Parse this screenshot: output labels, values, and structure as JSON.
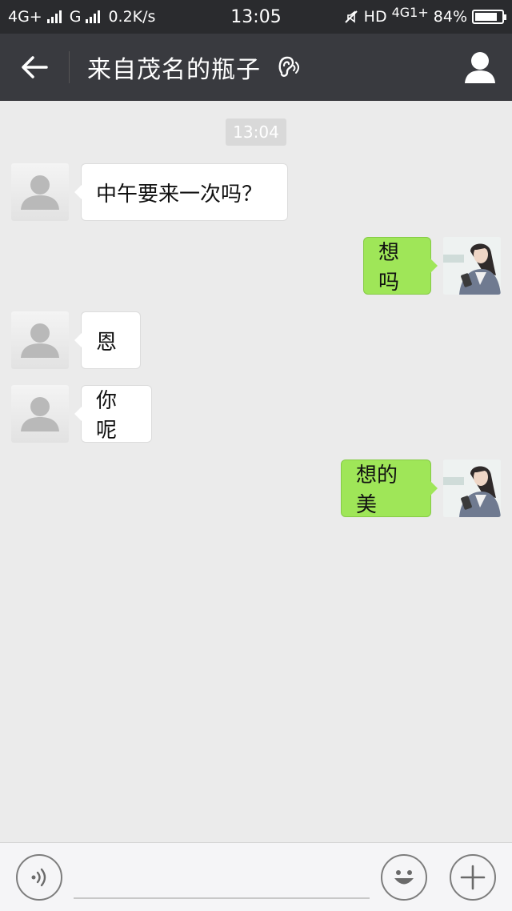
{
  "status_bar": {
    "network1": "4G+",
    "network2": "G",
    "speed": "0.2K/s",
    "time": "13:05",
    "hd_label": "HD",
    "network3": "4G",
    "network3_sub": "1+",
    "battery_text": "84%",
    "battery_level": 0.84
  },
  "header": {
    "title": "来自茂名的瓶子",
    "back_icon": "arrow-left-icon",
    "ear_icon": "ear-icon",
    "profile_icon": "person-icon"
  },
  "chat": {
    "timestamp": "13:04",
    "messages": [
      {
        "side": "in",
        "text": "中午要来一次吗？"
      },
      {
        "side": "out",
        "text": "想吗"
      },
      {
        "side": "in",
        "text": "恩"
      },
      {
        "side": "in",
        "text": "你呢"
      },
      {
        "side": "out",
        "text": "想的美"
      }
    ]
  },
  "input_bar": {
    "voice_icon": "voice-icon",
    "emoji_icon": "emoji-icon",
    "plus_icon": "plus-icon",
    "text_value": ""
  },
  "colors": {
    "status_bg": "#2a2b2e",
    "nav_bg": "#393a3f",
    "chat_bg": "#ebebeb",
    "bubble_out": "#9fe658",
    "bubble_in": "#ffffff"
  }
}
